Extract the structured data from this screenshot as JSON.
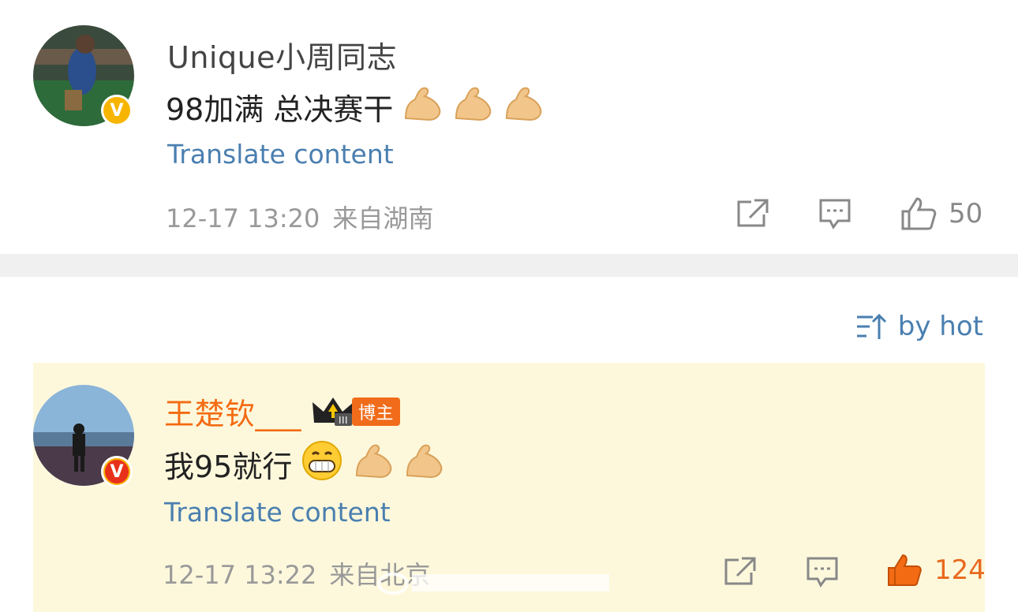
{
  "post": {
    "username": "Unique小周同志",
    "text": "98加满 总决赛干",
    "emojis": [
      "flexed-biceps",
      "flexed-biceps",
      "flexed-biceps"
    ],
    "translate_label": "Translate content",
    "time": "12-17 13:20",
    "location": "来自湖南",
    "verified": "V",
    "likes": "50"
  },
  "sort": {
    "label": "by hot"
  },
  "comment": {
    "username": "王楚钦___",
    "host_tag": "博主",
    "rank": "III",
    "text": "我95就行",
    "emojis": [
      "grinning-face",
      "flexed-biceps",
      "flexed-biceps"
    ],
    "translate_label": "Translate content",
    "time": "12-17 13:22",
    "location": "来自北京",
    "verified": "V",
    "likes": "124"
  },
  "colors": {
    "link": "#4a7fb0",
    "accent_orange": "#f36b12",
    "verified_gold": "#f7b500",
    "verified_red": "#e8311a",
    "highlight_bg": "#fdf8dc"
  }
}
